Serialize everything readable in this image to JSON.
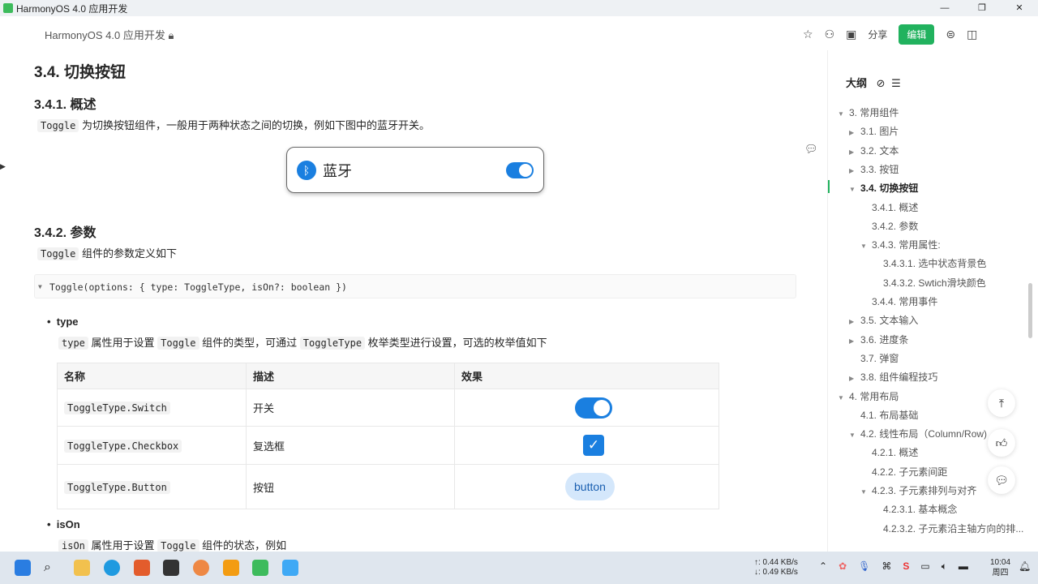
{
  "window": {
    "title": "HarmonyOS 4.0 应用开发"
  },
  "header": {
    "doc_title": "HarmonyOS 4.0 应用开发",
    "share": "分享",
    "edit": "编辑"
  },
  "content": {
    "h2": "3.4. 切换按钮",
    "h3_overview": "3.4.1. 概述",
    "overview_code": "Toggle",
    "overview_text": "为切换按钮组件，一般用于两种状态之间的切换，例如下图中的蓝牙开关。",
    "bluetooth_label": "蓝牙",
    "h3_params": "3.4.2. 参数",
    "params_code": "Toggle",
    "params_text": "组件的参数定义如下",
    "signature": "Toggle(options: { type: ToggleType, isOn?: boolean })",
    "type_bullet": "type",
    "type_desc": {
      "c1": "type",
      "t1": "属性用于设置",
      "c2": "Toggle",
      "t2": "组件的类型，可通过",
      "c3": "ToggleType",
      "t3": "枚举类型进行设置，可选的枚举值如下"
    },
    "table": {
      "headers": [
        "名称",
        "描述",
        "效果"
      ],
      "rows": [
        {
          "name": "ToggleType.Switch",
          "desc": "开关",
          "effect": "switch"
        },
        {
          "name": "ToggleType.Checkbox",
          "desc": "复选框",
          "effect": "checkbox"
        },
        {
          "name": "ToggleType.Button",
          "desc": "按钮",
          "effect": "button"
        }
      ],
      "button_label": "button"
    },
    "ison_bullet": "isOn",
    "ison_desc": {
      "c1": "isOn",
      "t1": "属性用于设置",
      "c2": "Toggle",
      "t2": "组件的状态，例如"
    }
  },
  "outline": {
    "title": "大纲",
    "items": [
      {
        "label": "3. 常用组件",
        "level": 1,
        "arrow": "down"
      },
      {
        "label": "3.1. 图片",
        "level": 2,
        "arrow": "right"
      },
      {
        "label": "3.2. 文本",
        "level": 2,
        "arrow": "right"
      },
      {
        "label": "3.3. 按钮",
        "level": 2,
        "arrow": "right"
      },
      {
        "label": "3.4. 切换按钮",
        "level": 2,
        "arrow": "down",
        "active": true
      },
      {
        "label": "3.4.1. 概述",
        "level": 3
      },
      {
        "label": "3.4.2. 参数",
        "level": 3
      },
      {
        "label": "3.4.3. 常用属性:",
        "level": 3,
        "arrow": "down"
      },
      {
        "label": "3.4.3.1. 选中状态背景色",
        "level": 4
      },
      {
        "label": "3.4.3.2. Swtich滑块颜色",
        "level": 4
      },
      {
        "label": "3.4.4. 常用事件",
        "level": 3
      },
      {
        "label": "3.5. 文本输入",
        "level": 2,
        "arrow": "right"
      },
      {
        "label": "3.6. 进度条",
        "level": 2,
        "arrow": "right"
      },
      {
        "label": "3.7. 弹窗",
        "level": 2
      },
      {
        "label": "3.8. 组件编程技巧",
        "level": 2,
        "arrow": "right"
      },
      {
        "label": "4. 常用布局",
        "level": 1,
        "arrow": "down"
      },
      {
        "label": "4.1. 布局基础",
        "level": 2
      },
      {
        "label": "4.2. 线性布局（Column/Row)",
        "level": 2,
        "arrow": "down"
      },
      {
        "label": "4.2.1. 概述",
        "level": 3
      },
      {
        "label": "4.2.2. 子元素间距",
        "level": 3
      },
      {
        "label": "4.2.3. 子元素排列与对齐",
        "level": 3,
        "arrow": "down"
      },
      {
        "label": "4.2.3.1. 基本概念",
        "level": 4
      },
      {
        "label": "4.2.3.2. 子元素沿主轴方向的排...",
        "level": 4
      }
    ]
  },
  "taskbar": {
    "net_up": "↑: 0.44 KB/s",
    "net_down": "↓: 0.49 KB/s",
    "time": "10:04",
    "day": "周四"
  },
  "colors": {
    "accent": "#1a7fe0",
    "edit": "#21b25e"
  }
}
